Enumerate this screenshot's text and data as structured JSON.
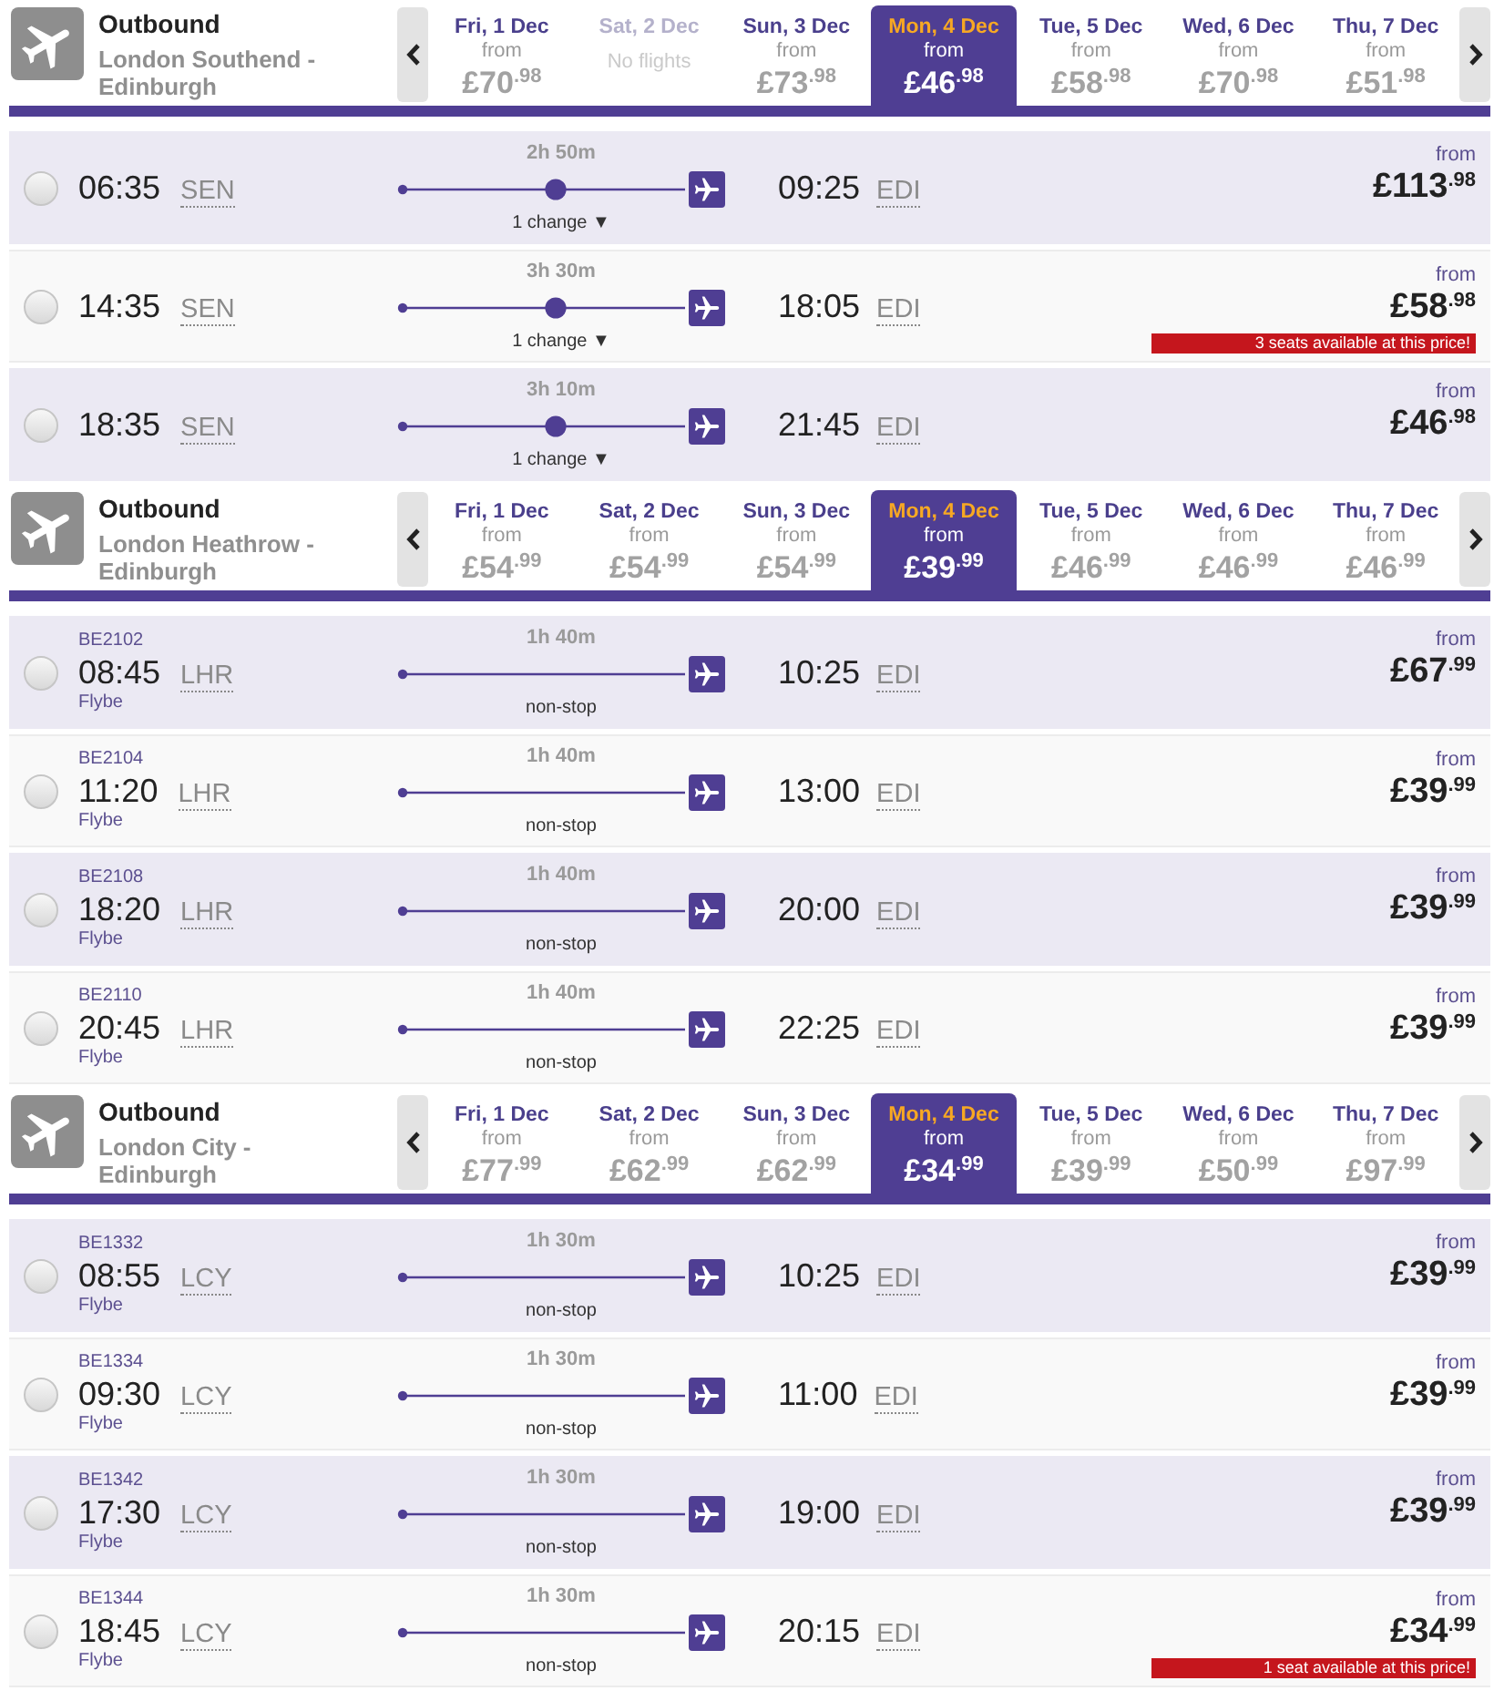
{
  "sections": [
    {
      "direction": "Outbound",
      "route": "London Southend - Edinburgh",
      "dates": [
        {
          "day": "Fri, 1 Dec",
          "from": "from",
          "price": "£70$^{.98}$",
          "selected": false,
          "disabled": false
        },
        {
          "day": "Sat, 2 Dec",
          "note": "No flights",
          "selected": false,
          "disabled": true
        },
        {
          "day": "Sun, 3 Dec",
          "from": "from",
          "price": "£73$^{.98}$",
          "selected": false,
          "disabled": false
        },
        {
          "day": "Mon, 4 Dec",
          "from": "from",
          "price": "£46$^{.98}$",
          "selected": true,
          "disabled": false
        },
        {
          "day": "Tue, 5 Dec",
          "from": "from",
          "price": "£58$^{.98}$",
          "selected": false,
          "disabled": false
        },
        {
          "day": "Wed, 6 Dec",
          "from": "from",
          "price": "£70$^{.98}$",
          "selected": false,
          "disabled": false
        },
        {
          "day": "Thu, 7 Dec",
          "from": "from",
          "price": "£51$^{.98}$",
          "selected": false,
          "disabled": false
        }
      ],
      "flights": [
        {
          "departure_time": "06:35",
          "departure_airport": "SEN",
          "duration": "2h 50m",
          "has_stop": true,
          "stops": "1 change ▼",
          "arrival_time": "09:25",
          "arrival_airport": "EDI",
          "price_label": "from",
          "price": "£113$^{.98}$",
          "selected": false
        },
        {
          "departure_time": "14:35",
          "departure_airport": "SEN",
          "duration": "3h 30m",
          "has_stop": true,
          "stops": "1 change ▼",
          "arrival_time": "18:05",
          "arrival_airport": "EDI",
          "price_label": "from",
          "price": "£58$^{.98}$",
          "availability": "3 seats available at this price!",
          "selected": false
        },
        {
          "departure_time": "18:35",
          "departure_airport": "SEN",
          "duration": "3h 10m",
          "has_stop": true,
          "stops": "1 change ▼",
          "arrival_time": "21:45",
          "arrival_airport": "EDI",
          "price_label": "from",
          "price": "£46$^{.98}$",
          "selected": false
        }
      ]
    },
    {
      "direction": "Outbound",
      "route": "London Heathrow - Edinburgh",
      "dates": [
        {
          "day": "Fri, 1 Dec",
          "from": "from",
          "price": "£54$^{.99}$",
          "selected": false,
          "disabled": false
        },
        {
          "day": "Sat, 2 Dec",
          "from": "from",
          "price": "£54$^{.99}$",
          "selected": false,
          "disabled": false
        },
        {
          "day": "Sun, 3 Dec",
          "from": "from",
          "price": "£54$^{.99}$",
          "selected": false,
          "disabled": false
        },
        {
          "day": "Mon, 4 Dec",
          "from": "from",
          "price": "£39$^{.99}$",
          "selected": true,
          "disabled": false
        },
        {
          "day": "Tue, 5 Dec",
          "from": "from",
          "price": "£46$^{.99}$",
          "selected": false,
          "disabled": false
        },
        {
          "day": "Wed, 6 Dec",
          "from": "from",
          "price": "£46$^{.99}$",
          "selected": false,
          "disabled": false
        },
        {
          "day": "Thu, 7 Dec",
          "from": "from",
          "price": "£46$^{.99}$",
          "selected": false,
          "disabled": false
        }
      ],
      "flights": [
        {
          "flight_number": "BE2102",
          "departure_time": "08:45",
          "departure_airport": "LHR",
          "airline": "Flybe",
          "duration": "1h 40m",
          "has_stop": false,
          "stops": "non-stop",
          "arrival_time": "10:25",
          "arrival_airport": "EDI",
          "price_label": "from",
          "price": "£67$^{.99}$",
          "selected": false
        },
        {
          "flight_number": "BE2104",
          "departure_time": "11:20",
          "departure_airport": "LHR",
          "airline": "Flybe",
          "duration": "1h 40m",
          "has_stop": false,
          "stops": "non-stop",
          "arrival_time": "13:00",
          "arrival_airport": "EDI",
          "price_label": "from",
          "price": "£39$^{.99}$",
          "selected": false
        },
        {
          "flight_number": "BE2108",
          "departure_time": "18:20",
          "departure_airport": "LHR",
          "airline": "Flybe",
          "duration": "1h 40m",
          "has_stop": false,
          "stops": "non-stop",
          "arrival_time": "20:00",
          "arrival_airport": "EDI",
          "price_label": "from",
          "price": "£39$^{.99}$",
          "selected": false
        },
        {
          "flight_number": "BE2110",
          "departure_time": "20:45",
          "departure_airport": "LHR",
          "airline": "Flybe",
          "duration": "1h 40m",
          "has_stop": false,
          "stops": "non-stop",
          "arrival_time": "22:25",
          "arrival_airport": "EDI",
          "price_label": "from",
          "price": "£39$^{.99}$",
          "selected": false
        }
      ]
    },
    {
      "direction": "Outbound",
      "route": "London City - Edinburgh",
      "dates": [
        {
          "day": "Fri, 1 Dec",
          "from": "from",
          "price": "£77$^{.99}$",
          "selected": false,
          "disabled": false
        },
        {
          "day": "Sat, 2 Dec",
          "from": "from",
          "price": "£62$^{.99}$",
          "selected": false,
          "disabled": false
        },
        {
          "day": "Sun, 3 Dec",
          "from": "from",
          "price": "£62$^{.99}$",
          "selected": false,
          "disabled": false
        },
        {
          "day": "Mon, 4 Dec",
          "from": "from",
          "price": "£34$^{.99}$",
          "selected": true,
          "disabled": false
        },
        {
          "day": "Tue, 5 Dec",
          "from": "from",
          "price": "£39$^{.99}$",
          "selected": false,
          "disabled": false
        },
        {
          "day": "Wed, 6 Dec",
          "from": "from",
          "price": "£50$^{.99}$",
          "selected": false,
          "disabled": false
        },
        {
          "day": "Thu, 7 Dec",
          "from": "from",
          "price": "£97$^{.99}$",
          "selected": false,
          "disabled": false
        }
      ],
      "flights": [
        {
          "flight_number": "BE1332",
          "departure_time": "08:55",
          "departure_airport": "LCY",
          "airline": "Flybe",
          "duration": "1h 30m",
          "has_stop": false,
          "stops": "non-stop",
          "arrival_time": "10:25",
          "arrival_airport": "EDI",
          "price_label": "from",
          "price": "£39$^{.99}$",
          "selected": false
        },
        {
          "flight_number": "BE1334",
          "departure_time": "09:30",
          "departure_airport": "LCY",
          "airline": "Flybe",
          "duration": "1h 30m",
          "has_stop": false,
          "stops": "non-stop",
          "arrival_time": "11:00",
          "arrival_airport": "EDI",
          "price_label": "from",
          "price": "£39$^{.99}$",
          "selected": false
        },
        {
          "flight_number": "BE1342",
          "departure_time": "17:30",
          "departure_airport": "LCY",
          "airline": "Flybe",
          "duration": "1h 30m",
          "has_stop": false,
          "stops": "non-stop",
          "arrival_time": "19:00",
          "arrival_airport": "EDI",
          "price_label": "from",
          "price": "£39$^{.99}$",
          "selected": false
        },
        {
          "flight_number": "BE1344",
          "departure_time": "18:45",
          "departure_airport": "LCY",
          "airline": "Flybe",
          "duration": "1h 30m",
          "has_stop": false,
          "stops": "non-stop",
          "arrival_time": "20:15",
          "arrival_airport": "EDI",
          "price_label": "from",
          "price": "£34$^{.99}$",
          "availability": "1 seat available at this price!",
          "selected": false
        }
      ]
    }
  ]
}
